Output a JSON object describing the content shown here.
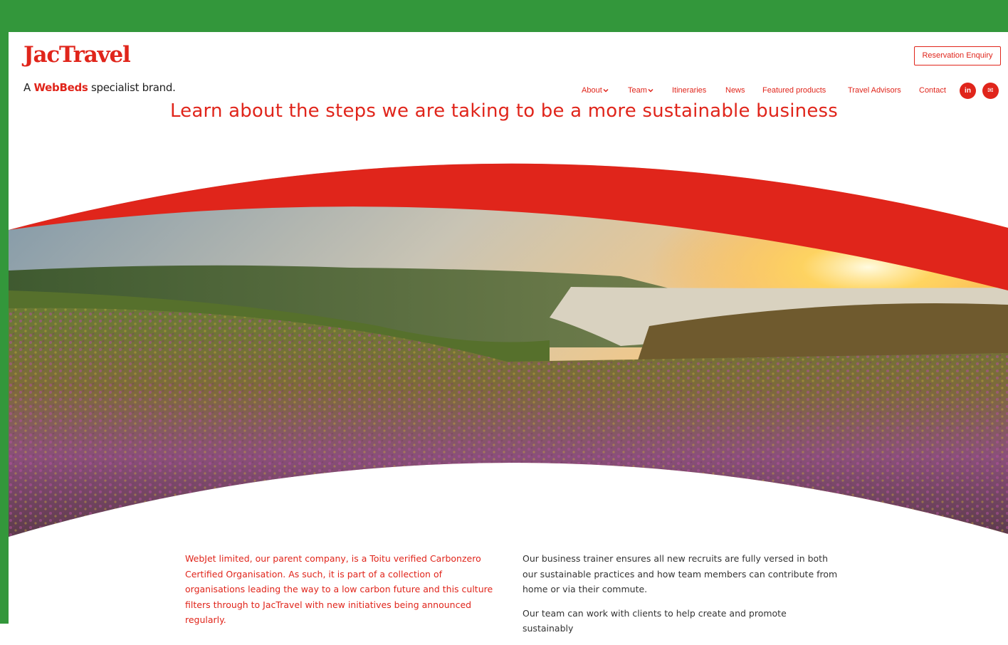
{
  "brand": {
    "logo_text": "JacTravel",
    "tagline_prefix": "A",
    "tagline_brand": "WebBeds",
    "tagline_suffix": "specialist brand."
  },
  "header": {
    "reservation_button": "Reservation Enquiry",
    "nav": [
      {
        "label": "About",
        "has_dropdown": true
      },
      {
        "label": "Team",
        "has_dropdown": true
      },
      {
        "label": "Itineraries",
        "has_dropdown": false
      },
      {
        "label": "News",
        "has_dropdown": false
      },
      {
        "label": "Featured products",
        "has_dropdown": false
      },
      {
        "label": "Travel Advisors",
        "has_dropdown": false
      },
      {
        "label": "Contact",
        "has_dropdown": false
      }
    ],
    "social": [
      {
        "icon": "linkedin-icon",
        "glyph": "in"
      },
      {
        "icon": "email-icon",
        "glyph": "✉"
      }
    ]
  },
  "hero": {
    "headline": "Learn about the steps we are taking to be a more sustainable business",
    "image": "moorland-sunset-landscape"
  },
  "content": {
    "left_paragraphs": [
      "WebJet limited, our parent company, is a Toitu verified Carbonzero Certified Organisation. As such, it is part of a collection of organisations leading the way to a low carbon future and this culture filters through to JacTravel with new initiatives being announced regularly."
    ],
    "right_paragraphs": [
      "Our business trainer ensures all new recruits are fully versed in both our sustainable practices and how team members can contribute from home or via their commute.",
      "Our team can work with clients to help create and promote sustainably"
    ]
  },
  "colors": {
    "brand_red": "#e0251b",
    "frame_green": "#33973b",
    "text_dark": "#333333"
  }
}
